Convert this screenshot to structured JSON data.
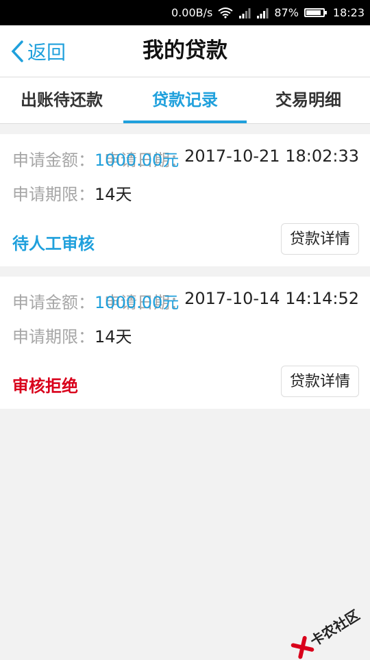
{
  "status_bar": {
    "speed": "0.00B/s",
    "battery_text": "87%",
    "battery_level": 0.87,
    "time": "18:23"
  },
  "header": {
    "back_label": "返回",
    "title": "我的贷款"
  },
  "tabs": [
    {
      "label": "出账待还款",
      "active": false
    },
    {
      "label": "贷款记录",
      "active": true
    },
    {
      "label": "交易明细",
      "active": false
    }
  ],
  "loans": [
    {
      "amount_label": "申请金额：",
      "amount": "1000.00元",
      "date_label": "申请日期：",
      "date": "2017-10-21  18:02:33",
      "term_label": "申请期限：",
      "term": "14天",
      "status": "待人工审核",
      "status_color": "#1fa0dc",
      "detail_label": "贷款详情"
    },
    {
      "amount_label": "申请金额：",
      "amount": "1000.00元",
      "date_label": "申请日期：",
      "date": "2017-10-14  14:14:52",
      "term_label": "申请期限：",
      "term": "14天",
      "status": "审核拒绝",
      "status_color": "#d9001b",
      "detail_label": "贷款详情"
    }
  ],
  "watermark": {
    "text": "卡农社区"
  },
  "colors": {
    "accent": "#1fa0dc",
    "reject": "#d9001b"
  }
}
